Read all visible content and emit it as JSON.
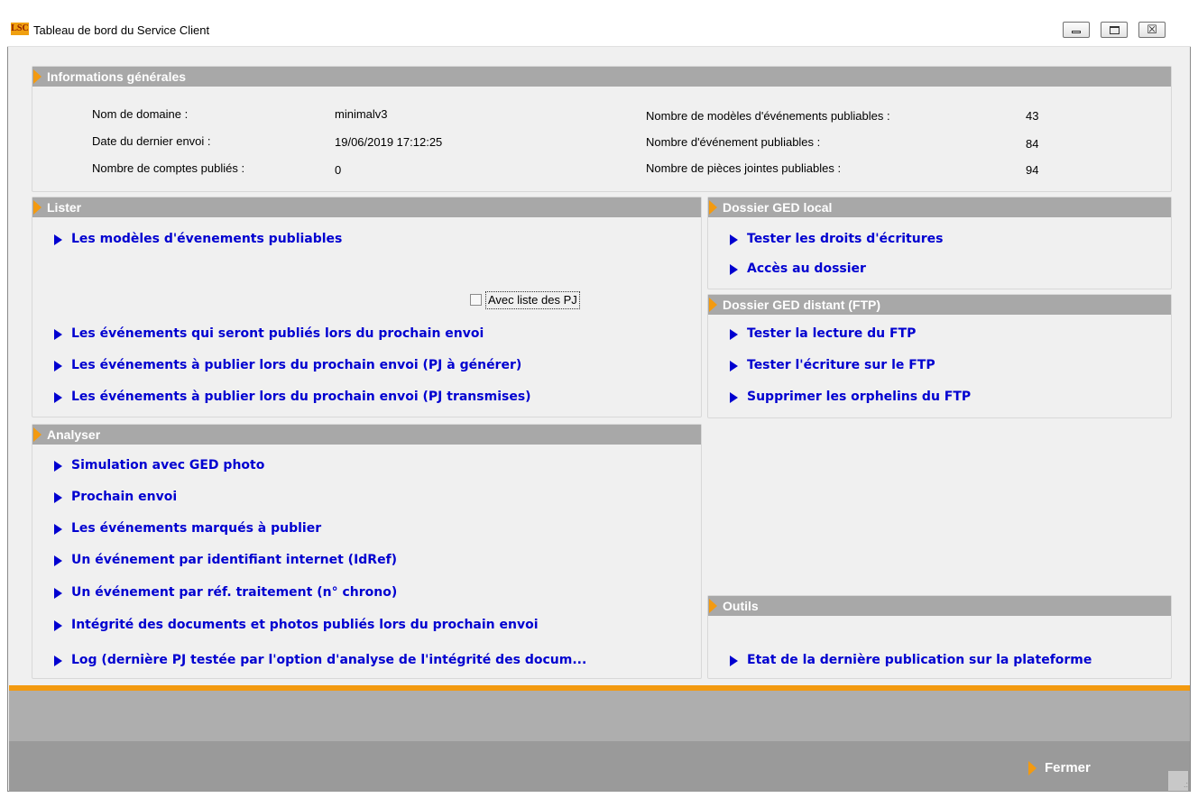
{
  "window": {
    "title": "Tableau de bord du Service Client",
    "logo_text": "LSC",
    "close_glyph": "☒"
  },
  "info": {
    "header": "Informations générales",
    "domain_label": "Nom de domaine :",
    "domain_value": "minimalv3",
    "last_send_label": "Date du dernier envoi :",
    "last_send_value": "19/06/2019 17:12:25",
    "accounts_label": "Nombre de comptes publiés :",
    "accounts_value": "0",
    "models_label": "Nombre de modèles d'événements publiables :",
    "models_value": "43",
    "events_label": "Nombre d'événement publiables :",
    "events_value": "84",
    "attachments_label": "Nombre de pièces jointes publiables :",
    "attachments_value": "94"
  },
  "lister": {
    "header": "Lister",
    "item_models": "Les modèles d'évenements publiables",
    "checkbox_label": "Avec liste des PJ",
    "item_next_send": "Les événements qui seront publiés lors du prochain envoi",
    "item_pj_generate": "Les événements à publier lors du prochain envoi (PJ à générer)",
    "item_pj_sent": "Les événements à publier lors du prochain envoi (PJ transmises)"
  },
  "ged_local": {
    "header": "Dossier GED local",
    "item_test_rights": "Tester les droits d'écritures",
    "item_access": "Accès au dossier"
  },
  "ged_remote": {
    "header": "Dossier GED distant (FTP)",
    "item_read": "Tester la lecture du FTP",
    "item_write": "Tester l'écriture sur le FTP",
    "item_orphans": "Supprimer les orphelins du FTP"
  },
  "analyser": {
    "header": "Analyser",
    "item_simulation": "Simulation avec GED photo",
    "item_next": "Prochain envoi",
    "item_marked": "Les événements marqués à publier",
    "item_by_id": "Un événement par identifiant internet (IdRef)",
    "item_by_ref": "Un événement par réf. traitement (n° chrono)",
    "item_integrity": "Intégrité des documents et photos publiés lors du prochain envoi",
    "item_log": "Log (dernière PJ testée par l'option d'analyse de l'intégrité des docum..."
  },
  "outils": {
    "header": "Outils",
    "item_state": "Etat de la dernière publication sur la plateforme"
  },
  "footer": {
    "close_label": "Fermer"
  }
}
